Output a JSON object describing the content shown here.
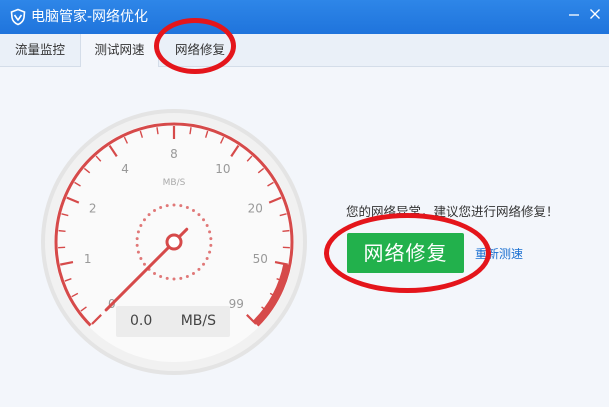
{
  "window": {
    "title": "电脑管家-网络优化",
    "icon": "shield-icon",
    "controls": [
      "minimize-icon",
      "close-icon"
    ],
    "titlebar_color": "#2479e1"
  },
  "tabs": [
    {
      "label": "流量监控",
      "active": false
    },
    {
      "label": "测试网速",
      "active": true
    },
    {
      "label": "网络修复",
      "active": false
    }
  ],
  "gauge": {
    "unit_label": "MB/S",
    "tick_labels": [
      "0",
      "1",
      "2",
      "4",
      "8",
      "10",
      "20",
      "50",
      "99"
    ],
    "current_value": 0,
    "arc_color": "#d64a4a",
    "needle_color": "#d64a4a"
  },
  "speed_readout": {
    "value": "0.0",
    "unit": "MB/S"
  },
  "status": {
    "message": "您的网络异常，建议您进行网络修复！",
    "repair_button": "网络修复",
    "retest_link": "重新测速",
    "button_color": "#22b14c",
    "link_color": "#1a6fd1"
  },
  "annotations": {
    "color": "#e4151b",
    "circled": [
      "网络修复 tab",
      "网络修复 button"
    ]
  }
}
